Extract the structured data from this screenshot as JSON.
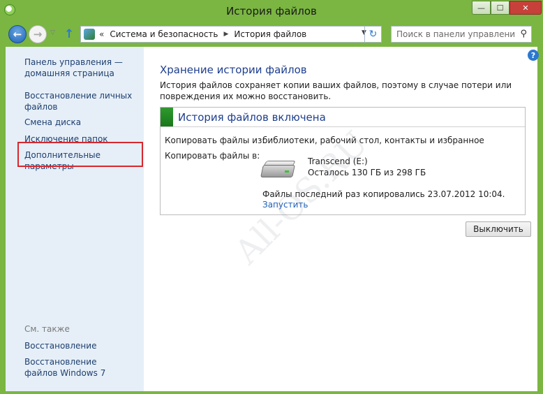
{
  "window": {
    "title": "История файлов",
    "controls": {
      "minimize": "—",
      "maximize": "☐",
      "close": "✕"
    }
  },
  "nav": {
    "back_glyph": "←",
    "forward_glyph": "→",
    "recent_glyph": "▽",
    "up_glyph": "↑",
    "address": {
      "separator": "«",
      "crumbs": [
        "Система и безопасность",
        "История файлов"
      ],
      "crumb_arrow": "▶",
      "dropdown_glyph": "▼",
      "refresh_glyph": "↻"
    },
    "search": {
      "placeholder": "Поиск в панели управления",
      "icon": "⚲"
    }
  },
  "sidebar": {
    "items": [
      {
        "label": "Панель управления — домашняя страница"
      },
      {
        "label": "Восстановление личных файлов"
      },
      {
        "label": "Смена диска"
      },
      {
        "label": "Исключение папок"
      },
      {
        "label": "Дополнительные параметры"
      }
    ],
    "see_also": {
      "heading": "См. также",
      "items": [
        {
          "label": "Восстановление"
        },
        {
          "label": "Восстановление файлов Windows 7"
        }
      ]
    }
  },
  "main": {
    "help_glyph": "?",
    "title": "Хранение истории файлов",
    "description": "История файлов сохраняет копии ваших файлов, поэтому в случае потери или повреждения их можно восстановить.",
    "panel": {
      "status_title": "История файлов включена",
      "copy_from_label": "Копировать файлы из:",
      "copy_from_value": "библиотеки, рабочий стол, контакты и избранное",
      "copy_to_label": "Копировать файлы в:",
      "drive_name": "Transcend (E:)",
      "drive_space": "Осталось 130 ГБ из 298 ГБ",
      "last_copy": "Файлы последний раз копировались 23.07.2012 10:04.",
      "run_link": "Запустить"
    },
    "turn_off_button": "Выключить"
  },
  "watermark": "All-OS.RU",
  "colors": {
    "frame": "#7ab641",
    "sidebar_bg": "#e6eff8",
    "link": "#1e5fb8",
    "heading": "#1e3f8e",
    "highlight_box": "#d8272d",
    "status_stripe": "#2f9a2f"
  },
  "icons": [
    "app-history-icon",
    "back-arrow-icon",
    "forward-arrow-icon",
    "up-arrow-icon",
    "refresh-icon",
    "search-icon",
    "help-icon",
    "hard-drive-icon"
  ]
}
